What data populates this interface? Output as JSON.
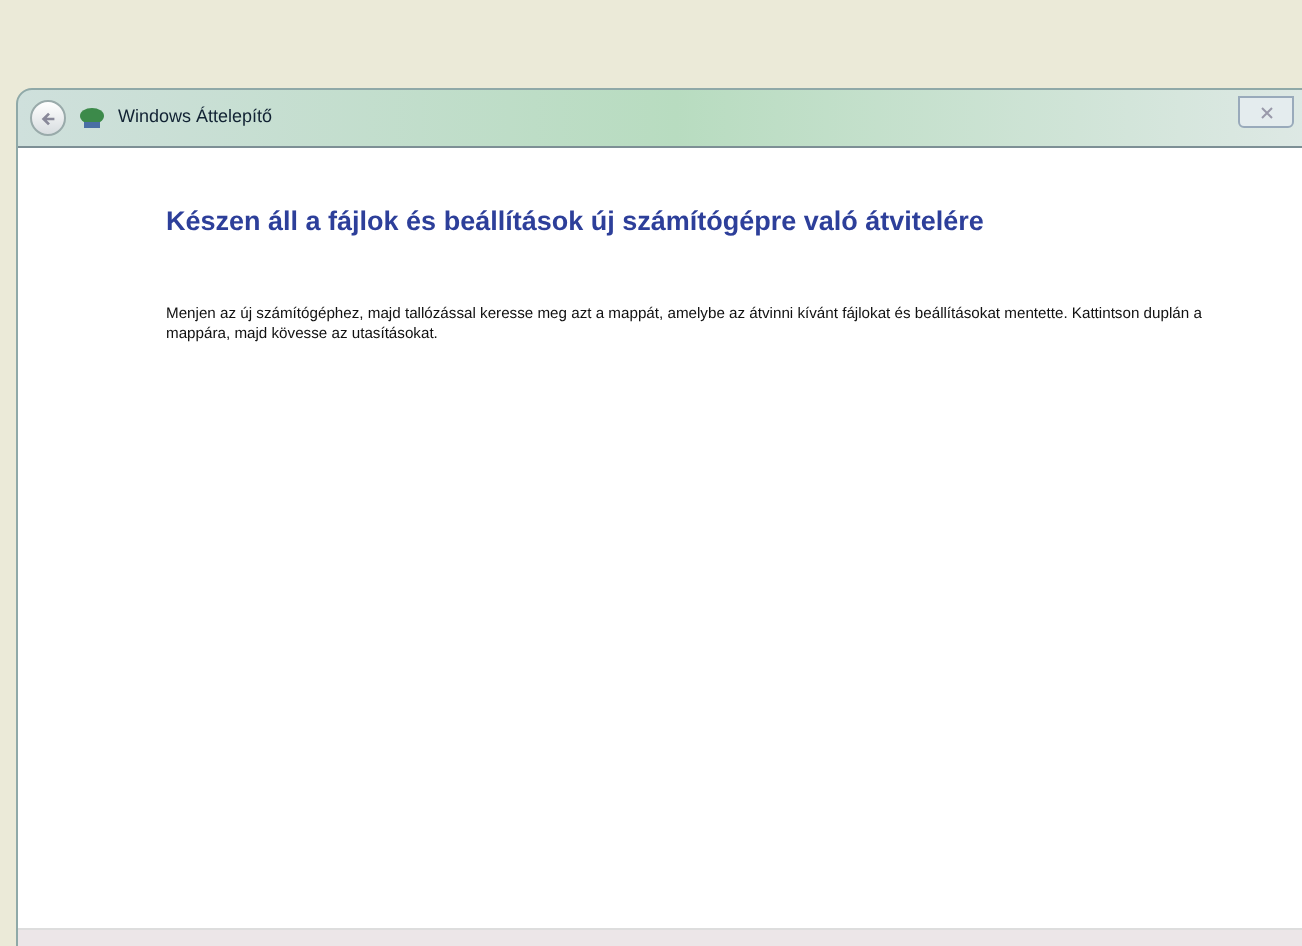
{
  "window": {
    "title": "Windows Áttelepítő"
  },
  "heading": "Készen áll a fájlok és beállítások új számítógépre való átvitelére",
  "body": "Menjen az új számítógéphez, majd tallózással keresse meg azt a mappát, amelybe az átvinni kívánt fájlokat és beállításokat mentette. Kattintson duplán a mappára, majd kövesse az utasításokat."
}
